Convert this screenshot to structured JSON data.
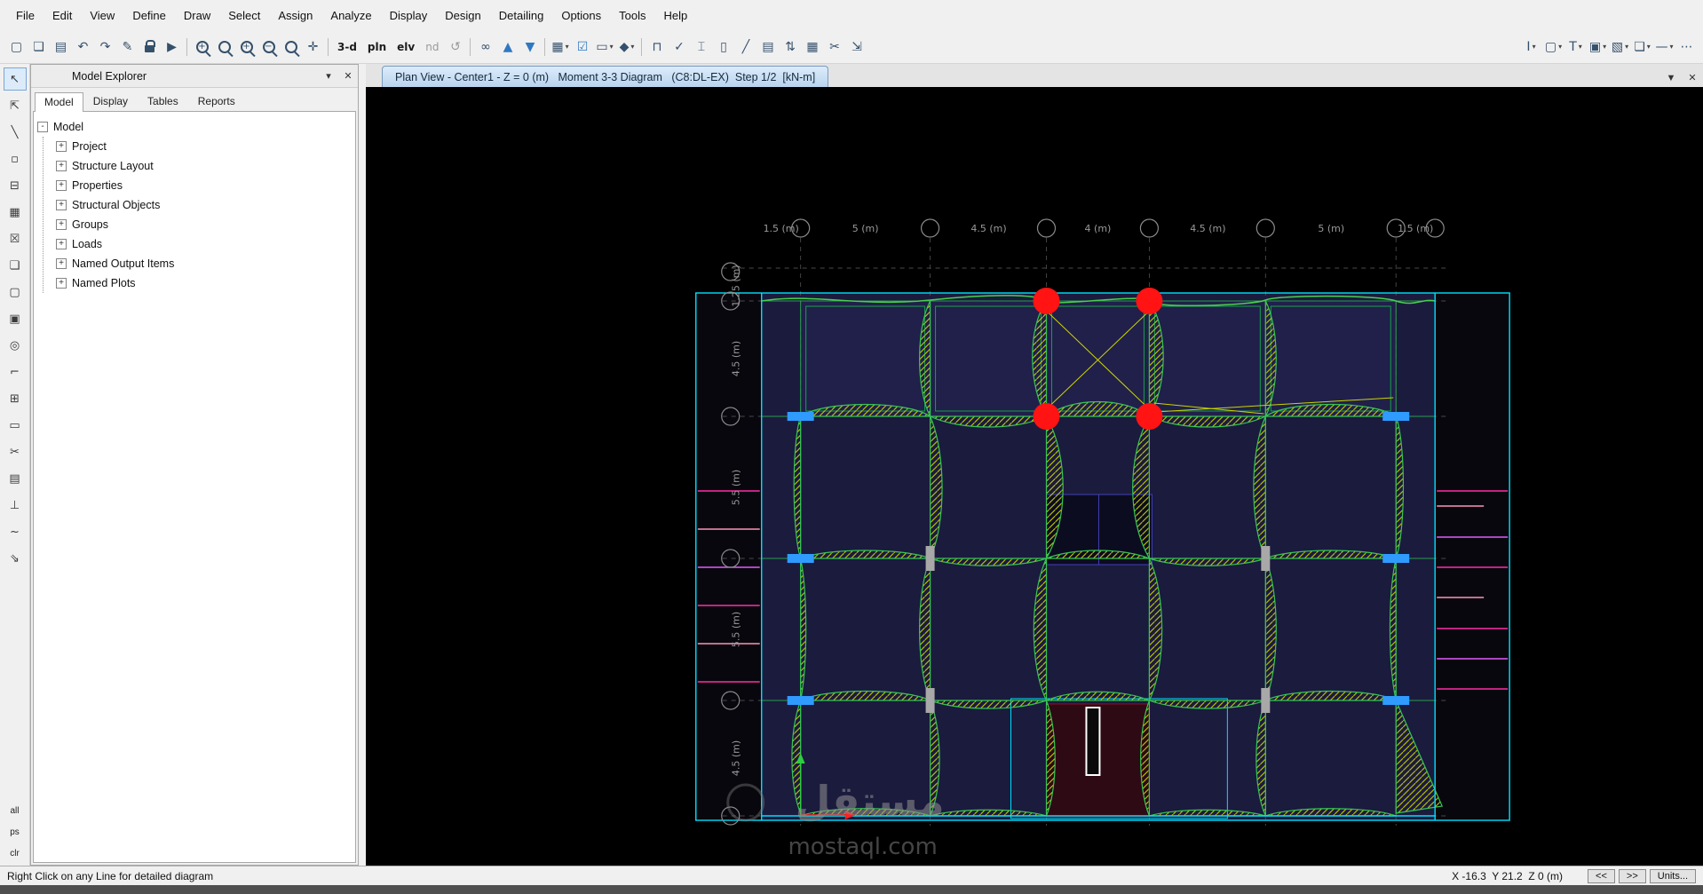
{
  "menu": {
    "items": [
      "File",
      "Edit",
      "View",
      "Define",
      "Draw",
      "Select",
      "Assign",
      "Analyze",
      "Display",
      "Design",
      "Detailing",
      "Options",
      "Tools",
      "Help"
    ]
  },
  "toolbar": {
    "text_buttons": {
      "threed": "3-d",
      "plan": "pln",
      "elev": "elv",
      "nd": "nd"
    }
  },
  "icons": {
    "new_model": "▢",
    "open_model": "❏",
    "save_model": "▤",
    "undo": "↶",
    "redo": "↷",
    "edit_pencil": "✎",
    "run_analysis": "▶",
    "zoom_window_sign": "+",
    "zoom_full_sign": "",
    "zoom_in_sign": "+",
    "zoom_out_sign": "−",
    "zoom_prev_sign": "",
    "pan_hand": "✛",
    "refresh_view": "↺",
    "view_glasses": "∞",
    "story_up": "▲",
    "story_down": "▼",
    "grid_options": "▦",
    "select_check": "☑",
    "frame_assign": "▭",
    "shell_assign": "◆",
    "dropdown": "▾",
    "draw_portal": "⊓",
    "check_ok": "✓",
    "ibeam": "⌶",
    "column": "▯",
    "brace": "╱",
    "stack": "▤",
    "swap_updown": "⇅",
    "mesh": "▦",
    "cut": "✂",
    "fit_view": "⇲",
    "text_cursor": "I",
    "display_box": "▢",
    "label_t": "T",
    "solid_box": "▣",
    "hatch_box": "▧",
    "frame_box": "❏",
    "line_dash": "—",
    "more_dots": "⋯",
    "tab_dropdown": "▼",
    "close": "✕",
    "panel_dropdown": "▾",
    "side": {
      "select": "↖",
      "extrude": "⇱",
      "line": "╲",
      "point": "▫",
      "sel_box": "⊟",
      "grid": "▦",
      "clear": "☒",
      "sheet": "❏",
      "sheet2": "▢",
      "solid": "▣",
      "target": "◎",
      "corner": "⌐",
      "plus_box": "⊞",
      "rect": "▭",
      "scissors": "✂",
      "table": "▤",
      "perp": "⊥",
      "wave": "~",
      "slope": "⇘"
    }
  },
  "view_tab": {
    "title": "Plan View - Center1 - Z = 0 (m)   Moment 3-3 Diagram   (C8:DL-EX)  Step 1/2  [kN-m]"
  },
  "model_explorer": {
    "title": "Model Explorer",
    "tabs": [
      "Model",
      "Display",
      "Tables",
      "Reports"
    ],
    "glyphs": {
      "expand": "+",
      "collapse": "-"
    },
    "tree": {
      "root": "Model",
      "items": [
        "Project",
        "Structure Layout",
        "Properties",
        "Structural Objects",
        "Groups",
        "Loads",
        "Named Output Items",
        "Named Plots"
      ]
    }
  },
  "side_toolbar": {
    "all": "all",
    "ps": "ps",
    "clr": "clr"
  },
  "drawing": {
    "top_dims": [
      "1.5 (m)",
      "5 (m)",
      "4.5 (m)",
      "4 (m)",
      "4.5 (m)",
      "5 (m)",
      "1.5 (m)"
    ],
    "left_dims": [
      "1.25 (m)",
      "4.5 (m)",
      "5.5 (m)",
      "5.5 (m)",
      "4.5 (m)"
    ]
  },
  "watermark": {
    "arabic": "مستقل",
    "latin": "mostaql.com"
  },
  "status_bar": {
    "hint": "Right Click on any Line for detailed diagram",
    "coordinates": "X -16.3  Y 21.2  Z 0 (m)",
    "prev": "<<",
    "next": ">>",
    "units": "Units..."
  },
  "colors": {
    "accent_red": "#ff1313",
    "outline_cyan": "#00e0ff",
    "hatch_yellow": "#cdd400",
    "moment_green": "#35c553",
    "slab_navy": "#1b1b3e",
    "magenta": "#ff2fa8"
  }
}
